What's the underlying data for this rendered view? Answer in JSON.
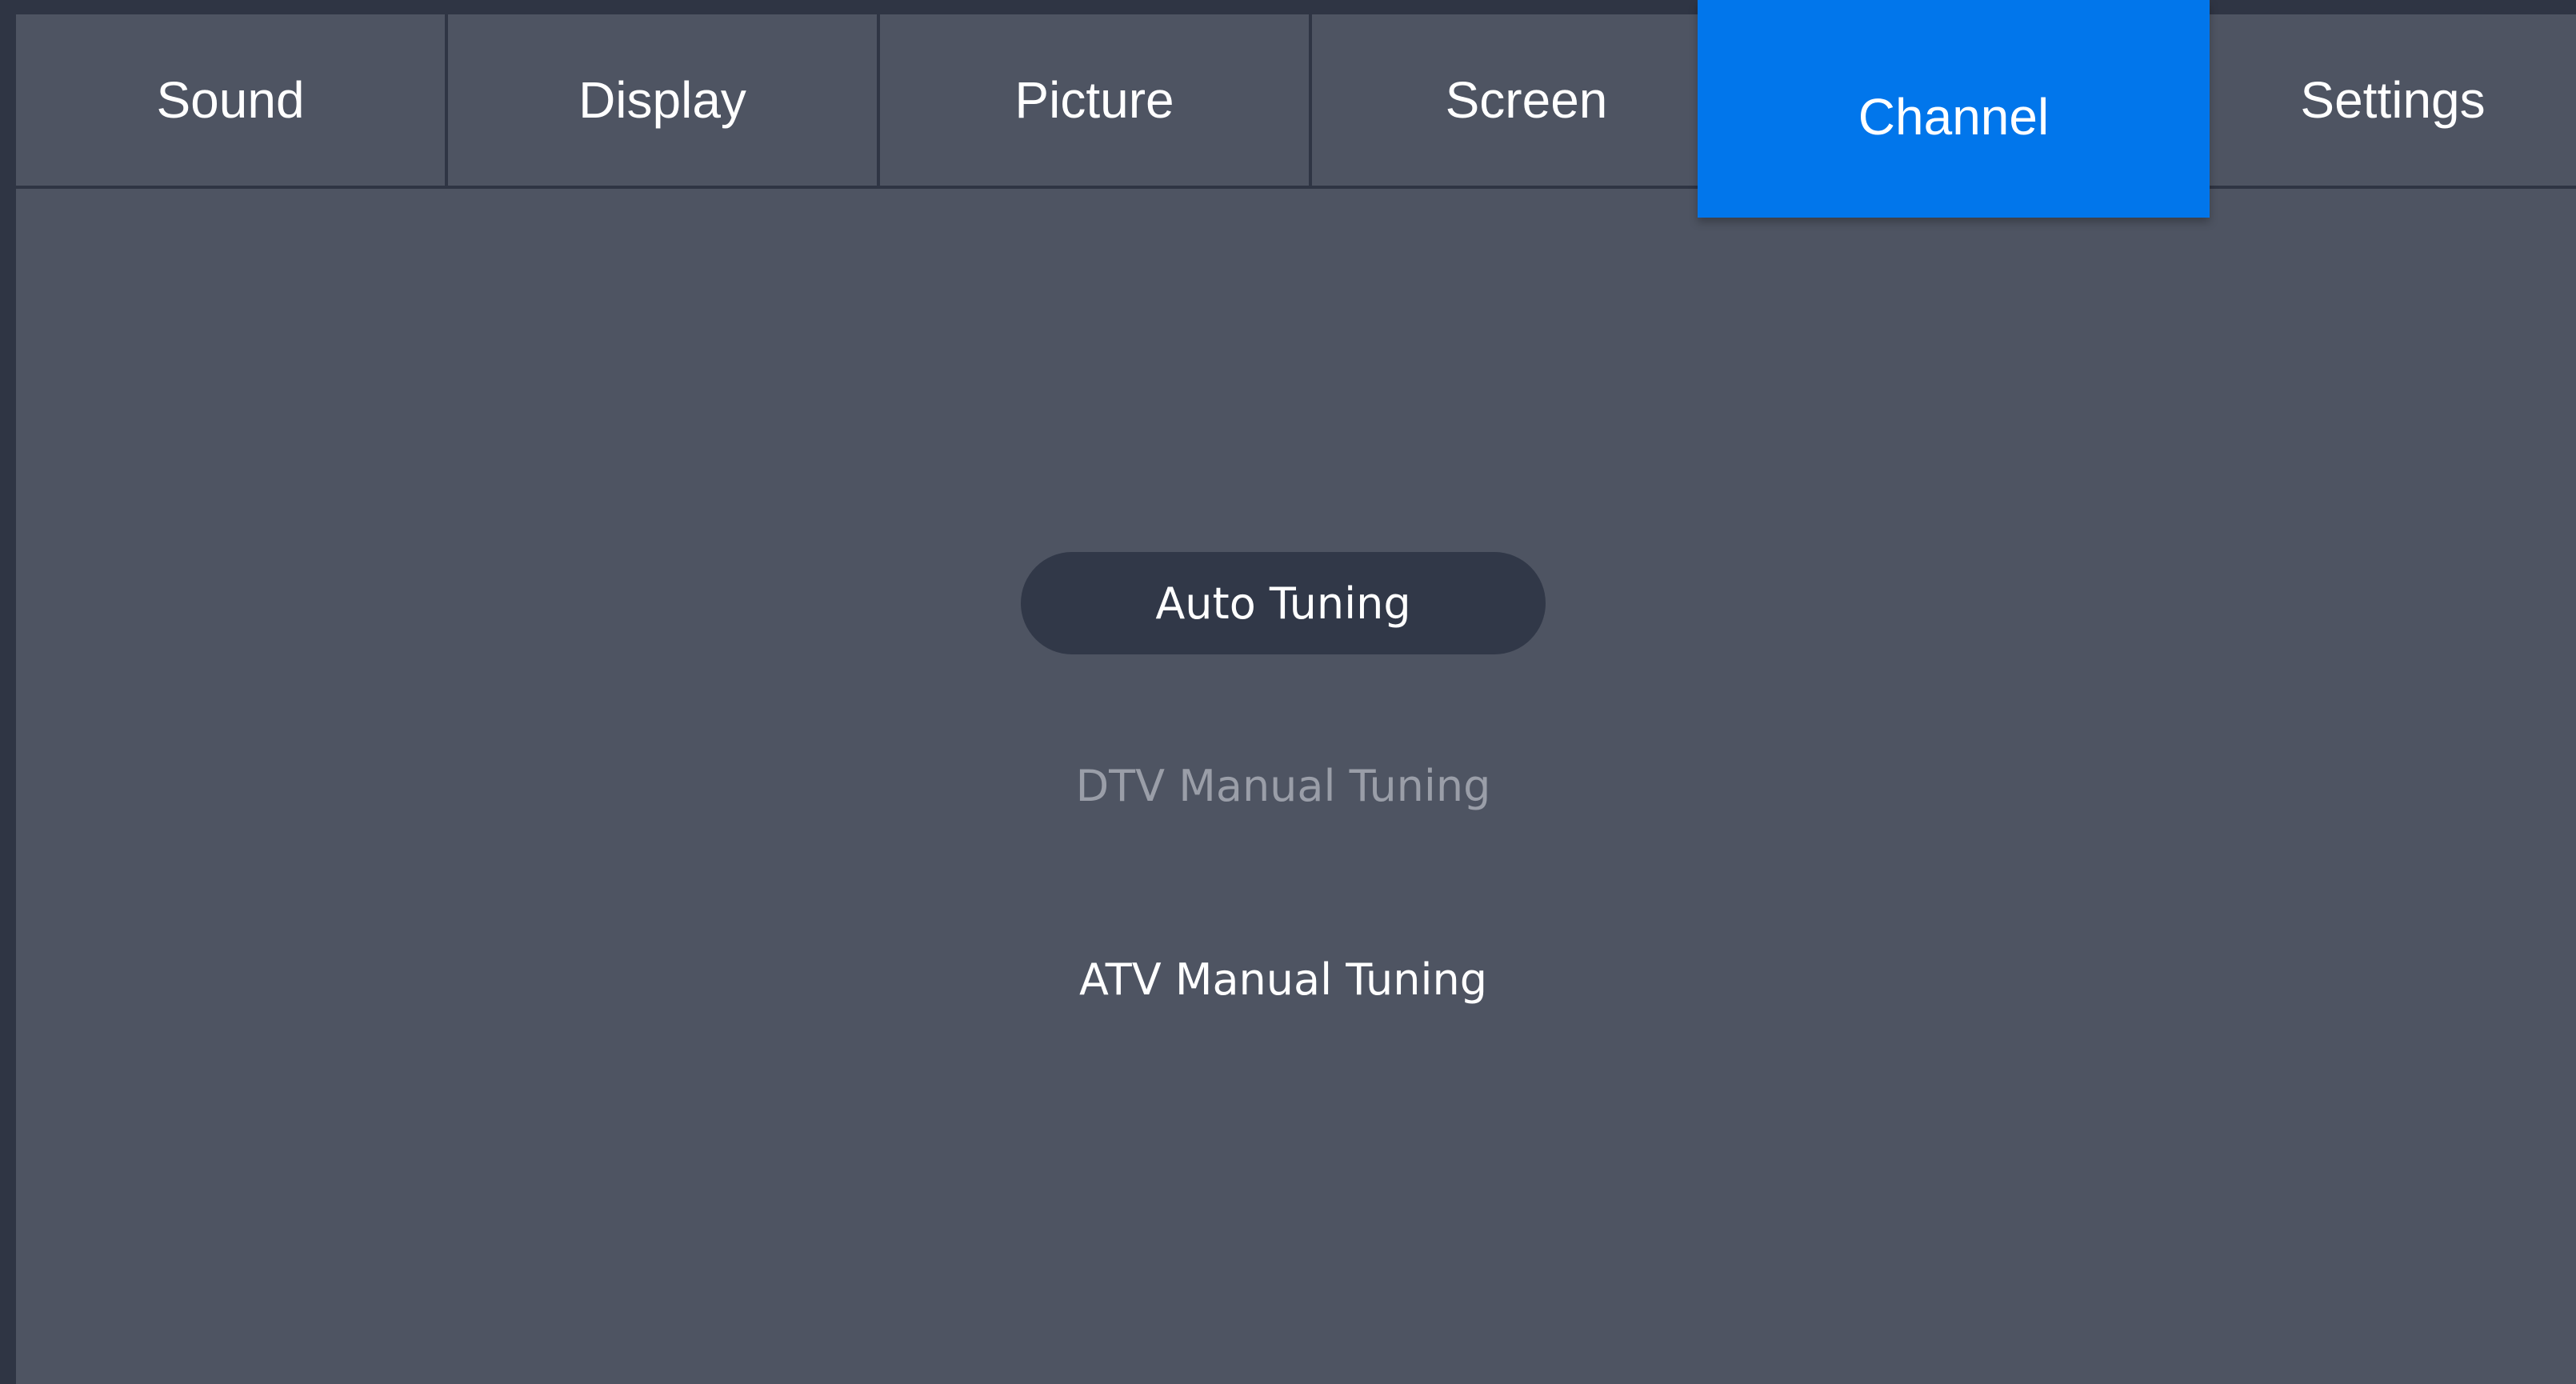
{
  "tabs": [
    {
      "label": "Sound",
      "active": false
    },
    {
      "label": "Display",
      "active": false
    },
    {
      "label": "Picture",
      "active": false
    },
    {
      "label": "Screen",
      "active": false
    },
    {
      "label": "Channel",
      "active": true
    },
    {
      "label": "Settings",
      "active": false
    }
  ],
  "menu": {
    "items": [
      {
        "label": "Auto Tuning",
        "state": "selected"
      },
      {
        "label": "DTV Manual Tuning",
        "state": "disabled"
      },
      {
        "label": "ATV Manual Tuning",
        "state": "normal"
      }
    ]
  },
  "colors": {
    "background": "#2f3544",
    "panel": "#4e5462",
    "active_tab": "#0176eb",
    "selected_item": "#313848",
    "disabled_text": "#9a9ea8",
    "text": "#ffffff"
  }
}
